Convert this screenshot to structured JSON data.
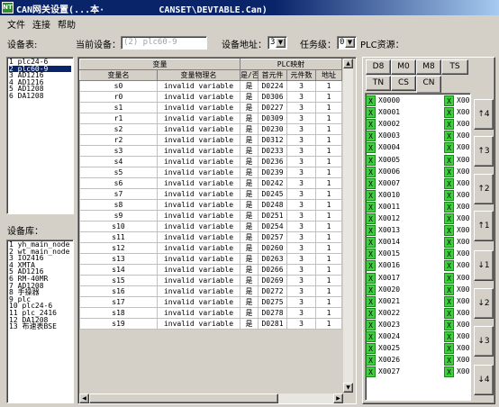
{
  "window": {
    "icon": "NT",
    "title": "CAN网关设置(...本·          CANSET\\DEVTABLE.Can)"
  },
  "menu": [
    "文件",
    "连接",
    "帮助"
  ],
  "toolbar": {
    "devices_label": "设备表:",
    "current_label": "当前设备：",
    "current_value": "(2) plc60-9",
    "address_label": "设备地址：",
    "address_value": "3",
    "task_label": "任务级：",
    "task_value": "0",
    "plc_label": "PLC资源："
  },
  "device_table": [
    "1 plc24-6",
    "2 plc60-9",
    "3 AD1216",
    "4 AD1216",
    "5 AD1208",
    "6 DA1208"
  ],
  "library": {
    "label": "设备库：",
    "items": [
      "1 yh_main_node",
      "2 wt_main_node",
      "3 IO2416",
      "4 XMTA",
      "5 AD1216",
      "6 RM-40MR",
      "7 AD1208",
      "8 手操器",
      "9 plc",
      "10 plc24-6",
      "11 plc_2416",
      "12 DA1208",
      "13 布速表BSE"
    ]
  },
  "grid": {
    "group_var": "变量",
    "group_plc": "PLC映射",
    "headers": [
      "变量名",
      "变量物理名",
      "是/否",
      "首元件",
      "元件数",
      "地址"
    ],
    "rows": [
      [
        "s0",
        "invalid variable",
        "是",
        "D0224",
        "3",
        "1"
      ],
      [
        "r0",
        "invalid variable",
        "是",
        "D0306",
        "3",
        "1"
      ],
      [
        "s1",
        "invalid variable",
        "是",
        "D0227",
        "3",
        "1"
      ],
      [
        "r1",
        "invalid variable",
        "是",
        "D0309",
        "3",
        "1"
      ],
      [
        "s2",
        "invalid variable",
        "是",
        "D0230",
        "3",
        "1"
      ],
      [
        "r2",
        "invalid variable",
        "是",
        "D0312",
        "3",
        "1"
      ],
      [
        "s3",
        "invalid variable",
        "是",
        "D0233",
        "3",
        "1"
      ],
      [
        "s4",
        "invalid variable",
        "是",
        "D0236",
        "3",
        "1"
      ],
      [
        "s5",
        "invalid variable",
        "是",
        "D0239",
        "3",
        "1"
      ],
      [
        "s6",
        "invalid variable",
        "是",
        "D0242",
        "3",
        "1"
      ],
      [
        "s7",
        "invalid variable",
        "是",
        "D0245",
        "3",
        "1"
      ],
      [
        "s8",
        "invalid variable",
        "是",
        "D0248",
        "3",
        "1"
      ],
      [
        "s9",
        "invalid variable",
        "是",
        "D0251",
        "3",
        "1"
      ],
      [
        "s10",
        "invalid variable",
        "是",
        "D0254",
        "3",
        "1"
      ],
      [
        "s11",
        "invalid variable",
        "是",
        "D0257",
        "3",
        "1"
      ],
      [
        "s12",
        "invalid variable",
        "是",
        "D0260",
        "3",
        "1"
      ],
      [
        "s13",
        "invalid variable",
        "是",
        "D0263",
        "3",
        "1"
      ],
      [
        "s14",
        "invalid variable",
        "是",
        "D0266",
        "3",
        "1"
      ],
      [
        "s15",
        "invalid variable",
        "是",
        "D0269",
        "3",
        "1"
      ],
      [
        "s16",
        "invalid variable",
        "是",
        "D0272",
        "3",
        "1"
      ],
      [
        "s17",
        "invalid variable",
        "是",
        "D0275",
        "3",
        "1"
      ],
      [
        "s18",
        "invalid variable",
        "是",
        "D0278",
        "3",
        "1"
      ],
      [
        "s19",
        "invalid variable",
        "是",
        "D0281",
        "3",
        "1"
      ]
    ]
  },
  "plc_tabs": {
    "row1": [
      "D8",
      "M0",
      "M8",
      "TS"
    ],
    "row2": [
      "TN",
      "CS",
      "CN"
    ],
    "active": "CN"
  },
  "plc_addresses": {
    "mark": "X",
    "col1": [
      "X0000",
      "X0001",
      "X0002",
      "X0003",
      "X0004",
      "X0005",
      "X0006",
      "X0007",
      "X0010",
      "X0011",
      "X0012",
      "X0013",
      "X0014",
      "X0015",
      "X0016",
      "X0017",
      "X0020",
      "X0021",
      "X0022",
      "X0023",
      "X0024",
      "X0025",
      "X0026",
      "X0027"
    ],
    "col2": [
      "X00",
      "X00",
      "X00",
      "X00",
      "X00",
      "X00",
      "X00",
      "X00",
      "X00",
      "X00",
      "X00",
      "X00",
      "X00",
      "X00",
      "X00",
      "X00",
      "X00",
      "X00",
      "X00",
      "X00",
      "X00",
      "X00",
      "X00",
      "X00"
    ]
  },
  "side_buttons": [
    "↑4",
    "↑3",
    "↑2",
    "↑1",
    "↓1",
    "↓2",
    "↓3",
    "↓4"
  ]
}
